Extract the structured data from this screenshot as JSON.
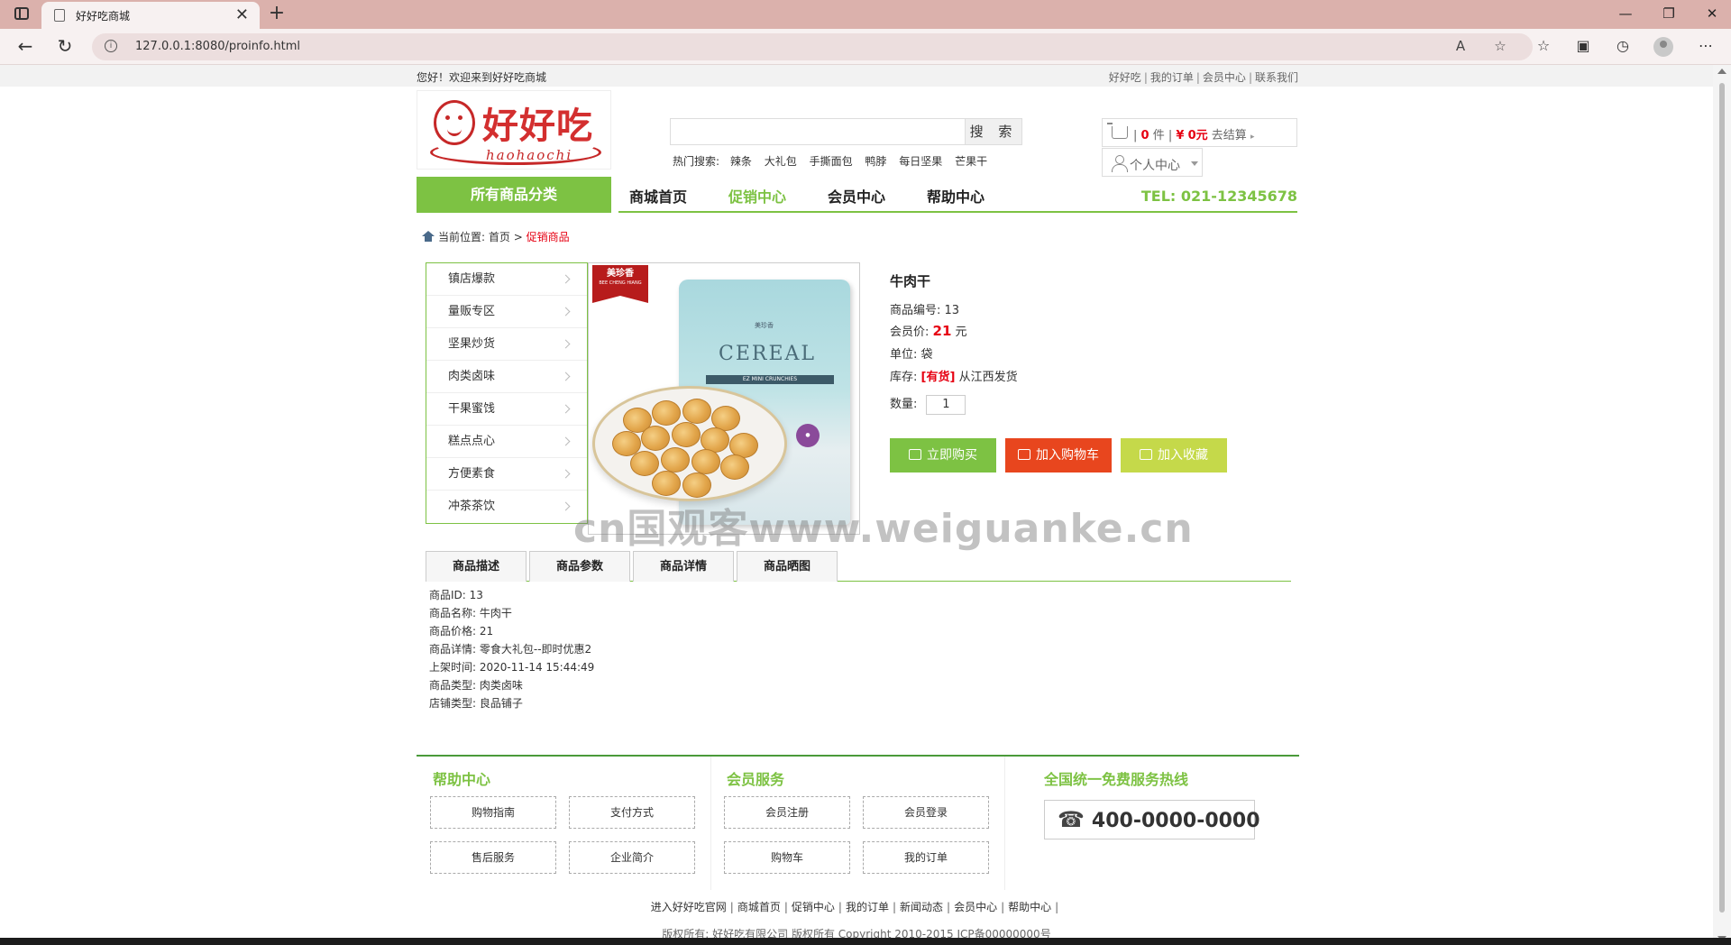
{
  "browser": {
    "tab_title": "好好吃商城",
    "url": "127.0.0.1:8080/proinfo.html",
    "new_tab_symbol": "+",
    "close_tab_symbol": "✕"
  },
  "topbar": {
    "welcome": "您好！欢迎来到好好吃商城",
    "links": [
      "好好吃",
      "我的订单",
      "会员中心",
      "联系我们"
    ],
    "sep": "|"
  },
  "logo": {
    "brand": "好好吃",
    "sub": "haohaochi"
  },
  "search": {
    "placeholder": "",
    "button": "搜 索",
    "hot_label": "热门搜索:",
    "hot_keywords": [
      "辣条",
      "大礼包",
      "手撕面包",
      "鸭脖",
      "每日坚果",
      "芒果干"
    ]
  },
  "cart": {
    "count": "0",
    "unit": "件",
    "currency": "¥",
    "amount": "0元",
    "checkout": "去结算",
    "sep": "|"
  },
  "user_center": "个人中心",
  "nav": {
    "all_categories": "所有商品分类",
    "items": [
      "商城首页",
      "促销中心",
      "会员中心",
      "帮助中心"
    ],
    "active_index": 1,
    "tel": "TEL:  021-12345678"
  },
  "breadcrumb": {
    "label": "当前位置:",
    "home": "首页",
    "sep": ">",
    "current": "促销商品"
  },
  "categories": [
    "镇店爆款",
    "量贩专区",
    "坚果炒货",
    "肉类卤味",
    "干果蜜饯",
    "糕点点心",
    "方便素食",
    "冲茶茶饮"
  ],
  "product_image": {
    "ribbon": "美珍香",
    "ribbon_sub": "BEE CHENG HIANG",
    "bag_text": "CEREAL",
    "bag_sub": "EZ MINI CRUNCHIES"
  },
  "product": {
    "name": "牛肉干",
    "code_label": "商品编号:",
    "code": "13",
    "price_label": "会员价:",
    "price": "21",
    "price_unit": "元",
    "unit_label": "单位:",
    "unit": "袋",
    "stock_label": "库存:",
    "stock": "[有货]",
    "ship_from": "从江西发货",
    "qty_label": "数量:",
    "qty": "1",
    "buttons": [
      {
        "label": "立即购买",
        "color": "#7dc243"
      },
      {
        "label": "加入购物车",
        "color": "#e8461e"
      },
      {
        "label": "加入收藏",
        "color": "#c5d94a"
      }
    ]
  },
  "tabs": [
    "商品描述",
    "商品参数",
    "商品详情",
    "商品晒图"
  ],
  "details": [
    "商品ID: 13",
    "商品名称: 牛肉干",
    "商品价格: 21",
    "商品详情: 零食大礼包--即时优惠2",
    "上架时间: 2020-11-14 15:44:49",
    "商品类型: 肉类卤味",
    "店铺类型: 良品铺子"
  ],
  "footer": {
    "help": {
      "title": "帮助中心",
      "items": [
        "购物指南",
        "支付方式",
        "售后服务",
        "企业简介"
      ]
    },
    "member": {
      "title": "会员服务",
      "items": [
        "会员注册",
        "会员登录",
        "购物车",
        "我的订单"
      ]
    },
    "hotline": {
      "title": "全国统一免费服务热线",
      "number": "400-0000-0000"
    }
  },
  "bottom_links": [
    "进入好好吃官网",
    "商城首页",
    "促销中心",
    "我的订单",
    "新闻动态",
    "会员中心",
    "帮助中心"
  ],
  "copyright": "版权所有: 好好吃有限公司 版权所有 Copyright 2010-2015 ICP备00000000号",
  "watermark": "cn国观客www.weiguanke.cn",
  "colors": {
    "accent_green": "#7dc243",
    "price_red": "#e60012",
    "tab_bar": "#dbb1ac"
  }
}
